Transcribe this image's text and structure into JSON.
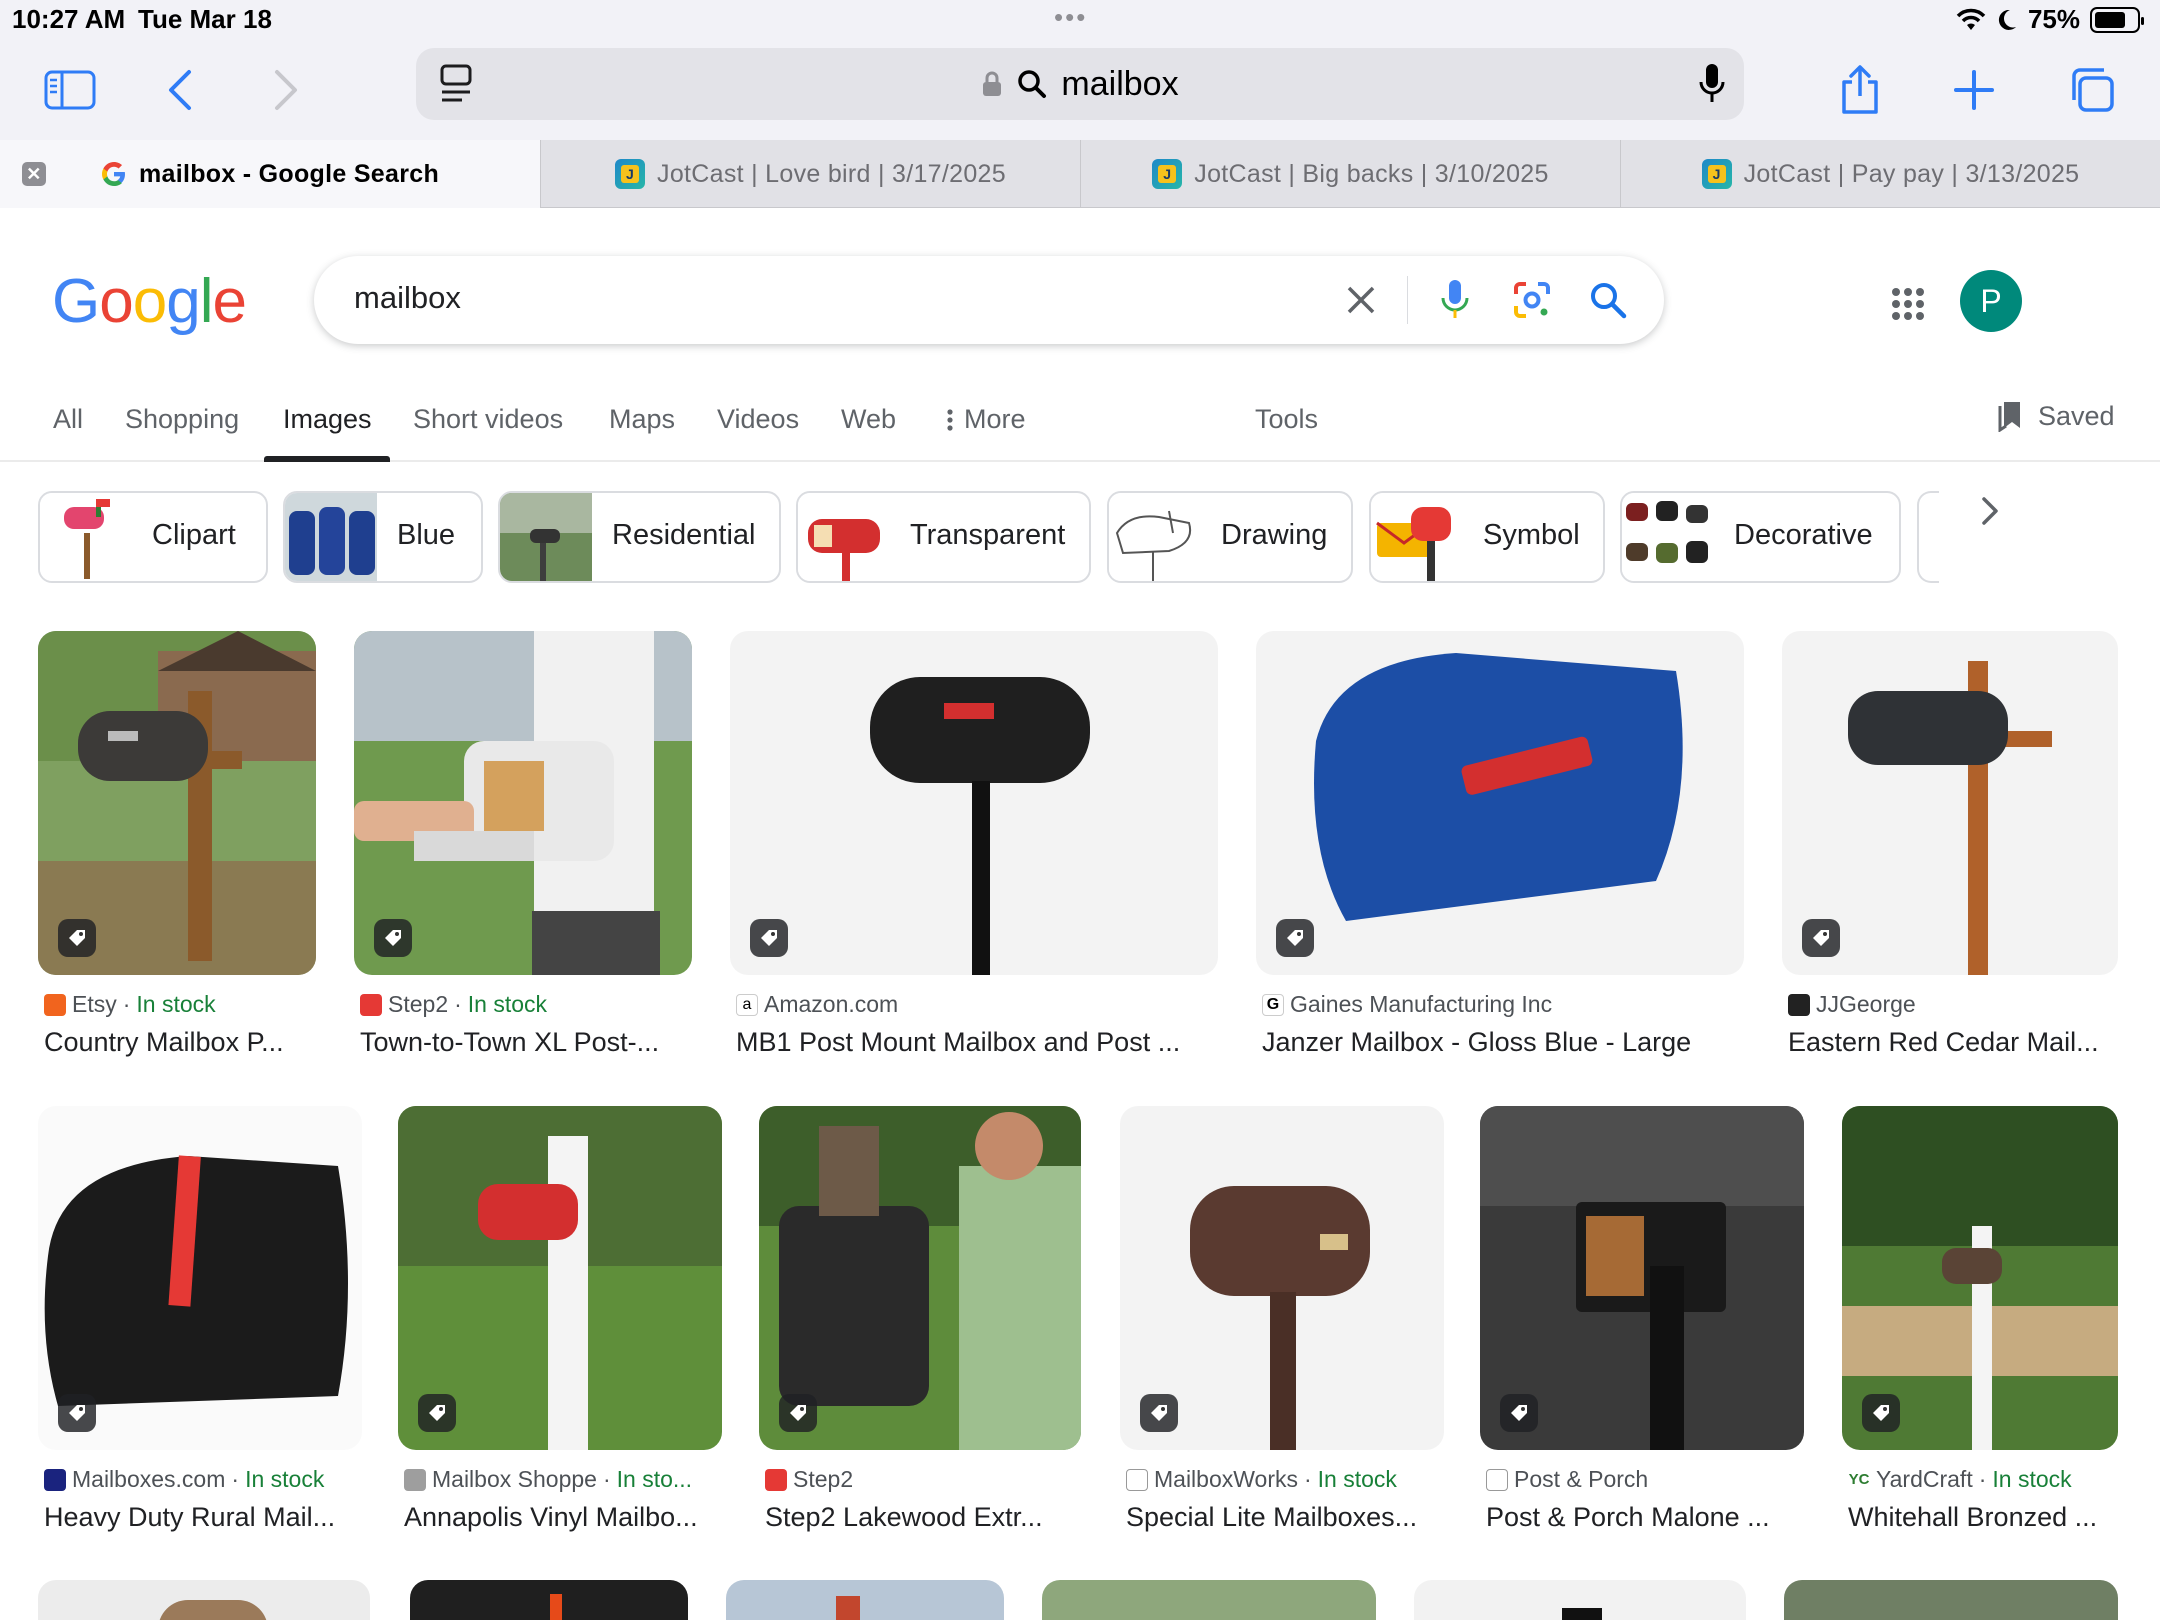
{
  "status": {
    "time": "10:27 AM",
    "date": "Tue Mar 18",
    "dots": "•••",
    "battery_text": "75%",
    "battery_level": 0.75
  },
  "toolbar": {
    "address_text": "mailbox"
  },
  "tabs": [
    {
      "label": "mailbox - Google Search",
      "active": true
    },
    {
      "label": "JotCast | Love bird | 3/17/2025",
      "active": false
    },
    {
      "label": "JotCast | Big backs | 3/10/2025",
      "active": false
    },
    {
      "label": "JotCast | Pay pay | 3/13/2025",
      "active": false
    }
  ],
  "google": {
    "query": "mailbox",
    "avatar_letter": "P"
  },
  "nav": {
    "items": [
      "All",
      "Shopping",
      "Images",
      "Short videos",
      "Maps",
      "Videos",
      "Web",
      "More",
      "Tools"
    ],
    "active": "Images",
    "saved": "Saved"
  },
  "chips": [
    "Clipart",
    "Blue",
    "Residential",
    "Transparent",
    "Drawing",
    "Symbol",
    "Decorative"
  ],
  "results": [
    {
      "source": "Etsy",
      "sep": " · ",
      "stock": "In stock",
      "title": "Country Mailbox P..."
    },
    {
      "source": "Step2",
      "sep": " · ",
      "stock": "In stock",
      "title": "Town-to-Town XL Post-..."
    },
    {
      "source": "Amazon.com",
      "sep": "",
      "stock": "",
      "title": "MB1 Post Mount Mailbox and Post ..."
    },
    {
      "source": "Gaines Manufacturing Inc",
      "sep": "",
      "stock": "",
      "title": "Janzer Mailbox - Gloss Blue - Large"
    },
    {
      "source": "JJGeorge",
      "sep": "",
      "stock": "",
      "title": "Eastern Red Cedar Mail..."
    },
    {
      "source": "Mailboxes.com",
      "sep": " · ",
      "stock": "In stock",
      "title": "Heavy Duty Rural Mail..."
    },
    {
      "source": "Mailbox Shoppe",
      "sep": " · ",
      "stock": "In sto...",
      "title": "Annapolis Vinyl Mailbo..."
    },
    {
      "source": "Step2",
      "sep": "",
      "stock": "",
      "title": "Step2 Lakewood Extr..."
    },
    {
      "source": "MailboxWorks",
      "sep": " · ",
      "stock": "In stock",
      "title": "Special Lite Mailboxes..."
    },
    {
      "source": "Post & Porch",
      "sep": "",
      "stock": "",
      "title": "Post & Porch Malone ..."
    },
    {
      "source": "YardCraft",
      "sep": " · ",
      "stock": "In stock",
      "title": "Whitehall Bronzed ..."
    }
  ],
  "colors": {
    "accent": "#1a73e8",
    "stock_green": "#188038",
    "safari_blue": "#2f7cf6"
  }
}
